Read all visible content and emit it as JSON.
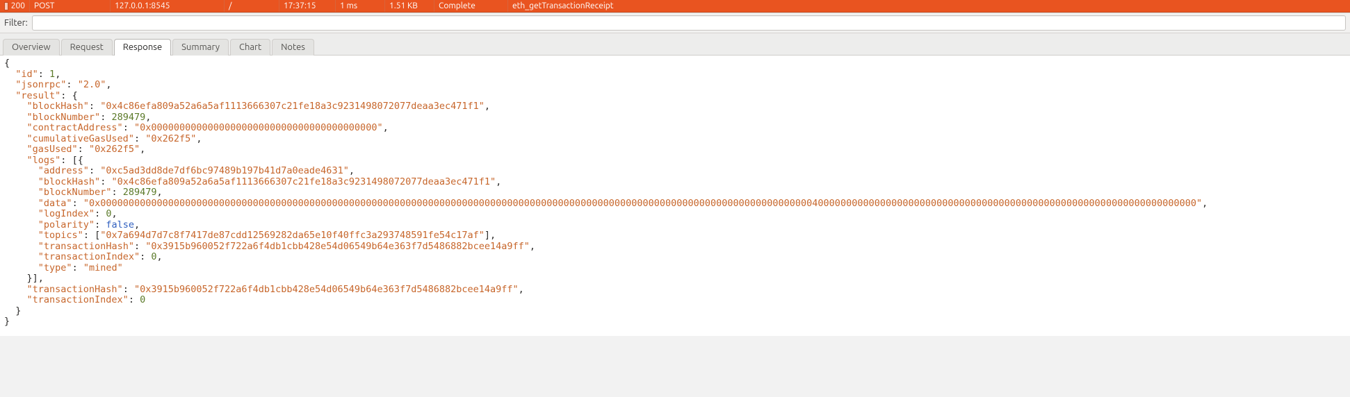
{
  "request_row": {
    "status_code": "200",
    "method": "POST",
    "host": "127.0.0.1:8545",
    "path": "/",
    "time": "17:37:15",
    "duration": "1 ms",
    "size": "1.51 KB",
    "state": "Complete",
    "name": "eth_getTransactionReceipt"
  },
  "filter": {
    "label": "Filter:",
    "value": ""
  },
  "tabs": [
    {
      "id": "overview",
      "label": "Overview"
    },
    {
      "id": "request",
      "label": "Request"
    },
    {
      "id": "response",
      "label": "Response"
    },
    {
      "id": "summary",
      "label": "Summary"
    },
    {
      "id": "chart",
      "label": "Chart"
    },
    {
      "id": "notes",
      "label": "Notes"
    }
  ],
  "active_tab": "response",
  "response_json": {
    "id": 1,
    "jsonrpc": "2.0",
    "result": {
      "blockHash": "0x4c86efa809a52a6a5af1113666307c21fe18a3c9231498072077deaa3ec471f1",
      "blockNumber": 289479,
      "contractAddress": "0x0000000000000000000000000000000000000000",
      "cumulativeGasUsed": "0x262f5",
      "gasUsed": "0x262f5",
      "logs": [
        {
          "address": "0xc5ad3dd8de7df6bc97489b197b41d7a0eade4631",
          "blockHash": "0x4c86efa809a52a6a5af1113666307c21fe18a3c9231498072077deaa3ec471f1",
          "blockNumber": 289479,
          "data": "0x00000000000000000000000000000000000000000000000000000000000000000000000000000000000000000000000000000000000000000000000000000040000000000000000000000000000000000000000000000000000000000000000000",
          "logIndex": 0,
          "polarity": false,
          "topics": [
            "0x7a694d7d7c8f7417de87cdd12569282da65e10f40ffc3a293748591fe54c17af"
          ],
          "transactionHash": "0x3915b960052f722a6f4db1cbb428e54d06549b64e363f7d5486882bcee14a9ff",
          "transactionIndex": 0,
          "type": "mined"
        }
      ],
      "transactionHash": "0x3915b960052f722a6f4db1cbb428e54d06549b64e363f7d5486882bcee14a9ff",
      "transactionIndex": 0
    }
  }
}
